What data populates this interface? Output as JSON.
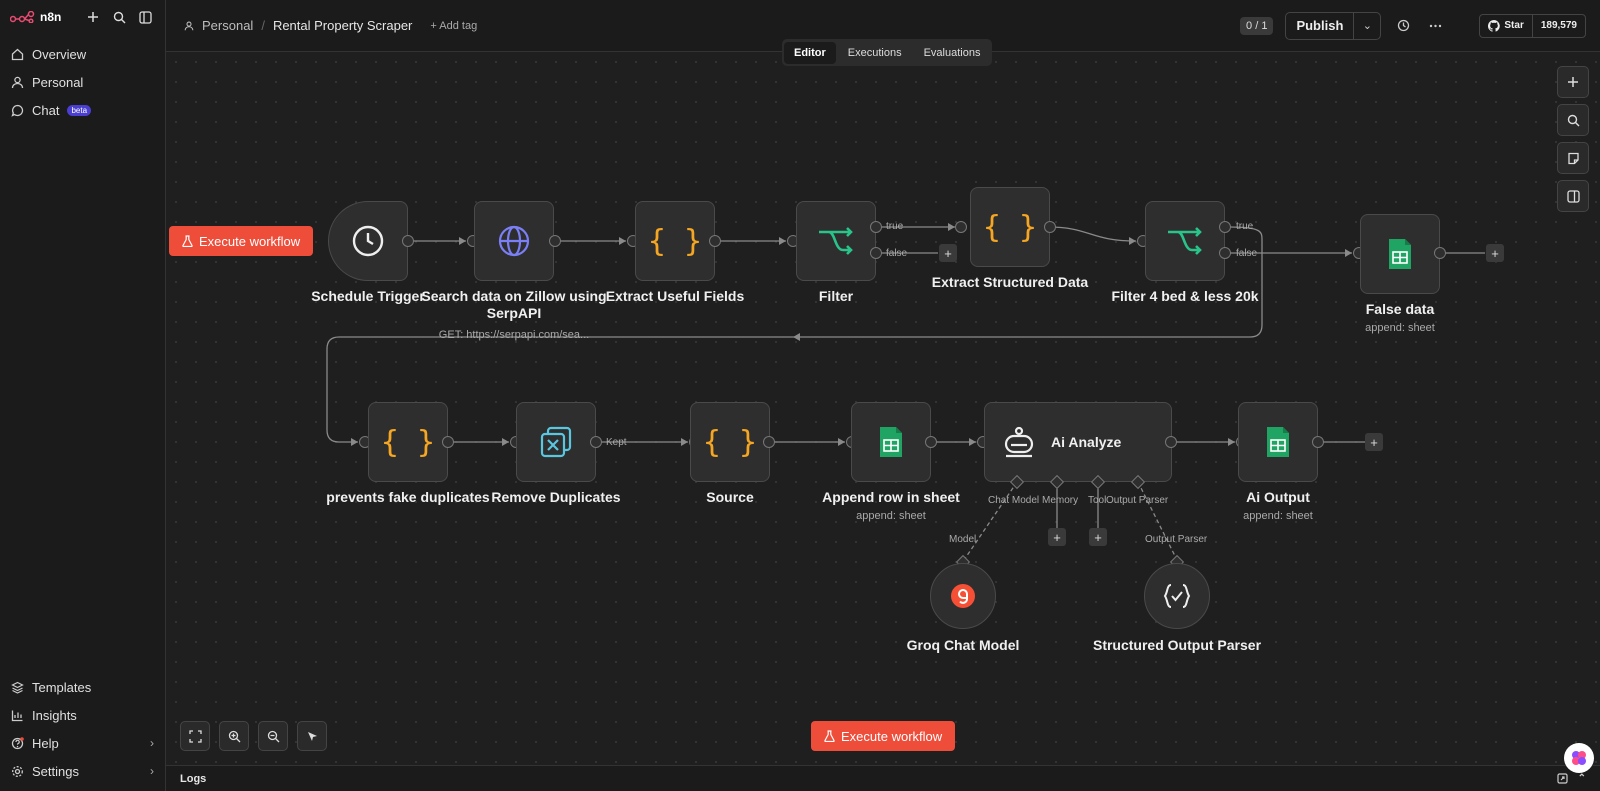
{
  "app": {
    "logo_text": "n8n"
  },
  "sidebar": {
    "items": [
      {
        "label": "Overview",
        "icon": "home-icon"
      },
      {
        "label": "Personal",
        "icon": "user-icon"
      },
      {
        "label": "Chat",
        "icon": "chat-icon",
        "badge": "beta"
      }
    ],
    "bottom_items": [
      {
        "label": "Templates",
        "icon": "templates-icon"
      },
      {
        "label": "Insights",
        "icon": "chart-icon"
      },
      {
        "label": "Help",
        "icon": "help-icon"
      },
      {
        "label": "Settings",
        "icon": "gear-icon"
      }
    ]
  },
  "header": {
    "breadcrumb_project": "Personal",
    "workflow_name": "Rental Property Scraper",
    "add_tag": "+ Add tag",
    "counter": "0 / 1",
    "publish": "Publish",
    "github_star": "Star",
    "github_count": "189,579"
  },
  "tabs": [
    "Editor",
    "Executions",
    "Evaluations"
  ],
  "canvas": {
    "execute_label": "Execute workflow",
    "nodes": {
      "schedule": "Schedule Trigger",
      "search": "Search data on Zillow using SerpAPI",
      "search_sub": "GET: https://serpapi.com/sea...",
      "extract_fields": "Extract Useful Fields",
      "filter": "Filter",
      "extract_structured": "Extract Structured Data",
      "filter4": "Filter 4 bed & less 20k",
      "false_data": "False data",
      "false_data_sub": "append: sheet",
      "prevents": "prevents fake duplicates",
      "remove_dup": "Remove Duplicates",
      "source": "Source",
      "append_row": "Append row in sheet",
      "append_row_sub": "append: sheet",
      "ai_analyze": "Ai Analyze",
      "ai_output": "Ai Output",
      "ai_output_sub": "append: sheet",
      "groq": "Groq Chat Model",
      "parser": "Structured Output Parser"
    },
    "edge_labels": {
      "true": "true",
      "false": "false",
      "kept": "Kept",
      "chat_model": "Chat Model",
      "memory": "Memory",
      "tool": "Tool",
      "output_parser": "Output Parser",
      "model": "Model",
      "output_parser2": "Output Parser"
    }
  },
  "logs": {
    "label": "Logs"
  }
}
